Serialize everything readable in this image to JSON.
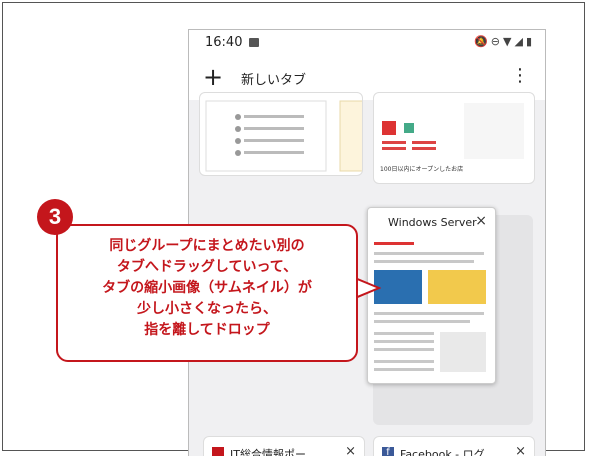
{
  "status_bar": {
    "time": "16:40",
    "icons": [
      "image-icon",
      "mute-icon",
      "dnd-icon",
      "wifi-icon",
      "signal-icon",
      "battery-icon"
    ]
  },
  "toolbar": {
    "add_icon": "+",
    "title": "新しいタブ",
    "menu_icon": "⋮"
  },
  "tabs": {
    "top_right_caption": "100日以内にオープンしたお店",
    "bottom_left_title": "IT総合情報ポー",
    "bottom_right_title": "Facebook - ログ",
    "close_glyph": "×"
  },
  "dragged_tab": {
    "title": "Windows Server",
    "close_glyph": "×"
  },
  "callout": {
    "number": "3",
    "lines": [
      "同じグループにまとめたい別の",
      "タブへドラッグしていって、",
      "タブの縮小画像（サムネイル）が",
      "少し小さくなったら、",
      "指を離してドロップ"
    ],
    "color": "#c4161c"
  }
}
